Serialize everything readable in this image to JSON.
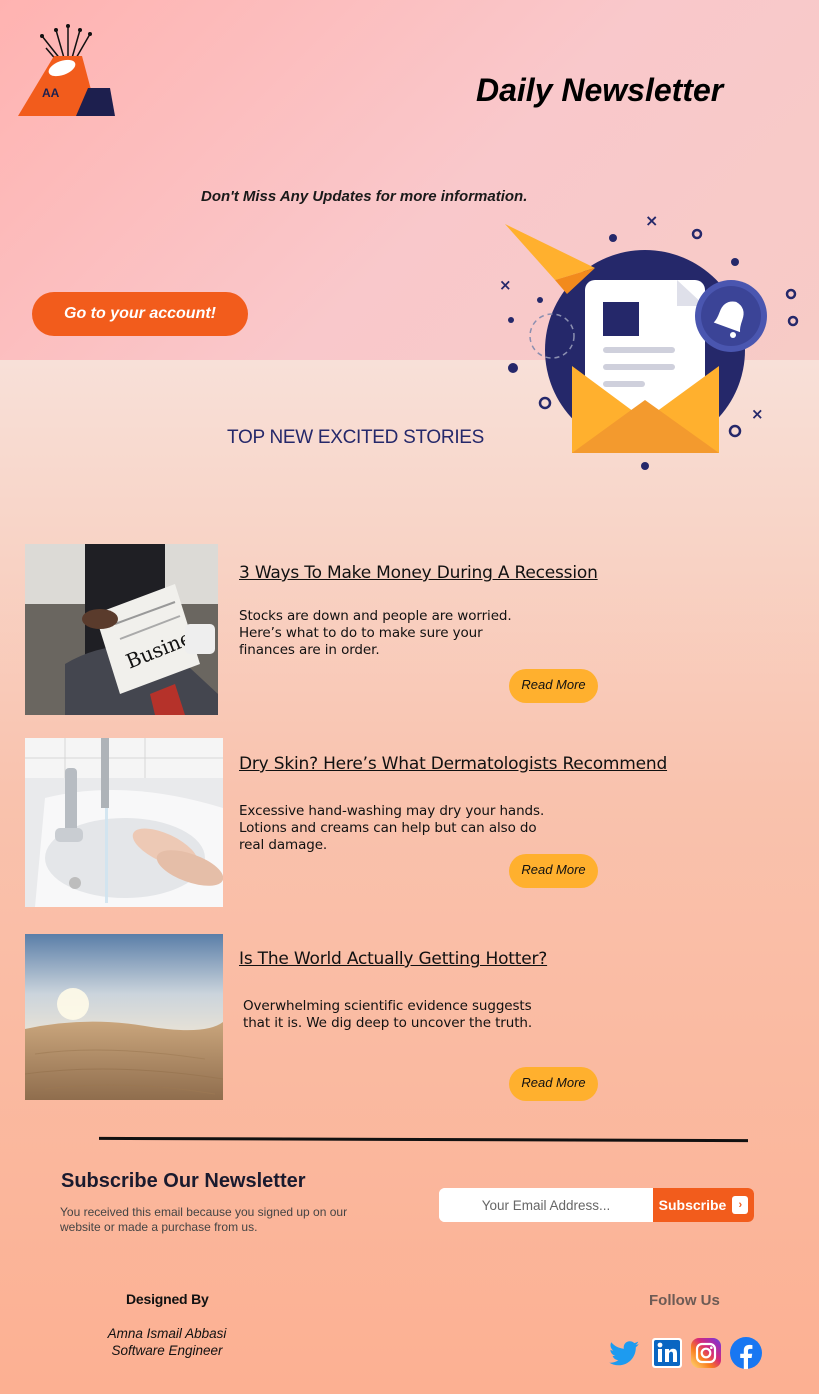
{
  "header": {
    "logo_text": "AA",
    "title": "Daily Newsletter",
    "tagline": "Don't Miss Any Updates for more information.",
    "account_button": "Go to your account!"
  },
  "section_title": "TOP NEW EXCITED STORIES",
  "stories": [
    {
      "title": "3 Ways To Make Money During A Recession",
      "description": "Stocks are down and people are worried. Here’s what to do to make sure your finances are in order.",
      "button": "Read More"
    },
    {
      "title": "Dry Skin? Here’s What Dermatologists Recommend",
      "description": "Excessive hand-washing may dry your hands. Lotions and creams can help but can also do real damage.",
      "button": "Read More"
    },
    {
      "title": "Is The World Actually Getting Hotter?",
      "description": "Overwhelming scientific evidence suggests that it is. We dig deep to uncover the truth.",
      "button": "Read More"
    }
  ],
  "subscribe": {
    "title": "Subscribe Our Newsletter",
    "description": "You received this email  because you signed up on our website or made a purchase from us.",
    "email_placeholder": "Your Email Address...",
    "button": "Subscribe"
  },
  "footer": {
    "designed_by_label": "Designed By",
    "designer_name": "Amna Ismail Abbasi",
    "designer_role": "Software Engineer",
    "follow_label": "Follow Us",
    "social": [
      "twitter-icon",
      "linkedin-icon",
      "instagram-icon",
      "facebook-icon"
    ]
  },
  "colors": {
    "accent_orange": "#f25c1c",
    "button_yellow": "#ffb02e",
    "navy": "#25286a"
  }
}
